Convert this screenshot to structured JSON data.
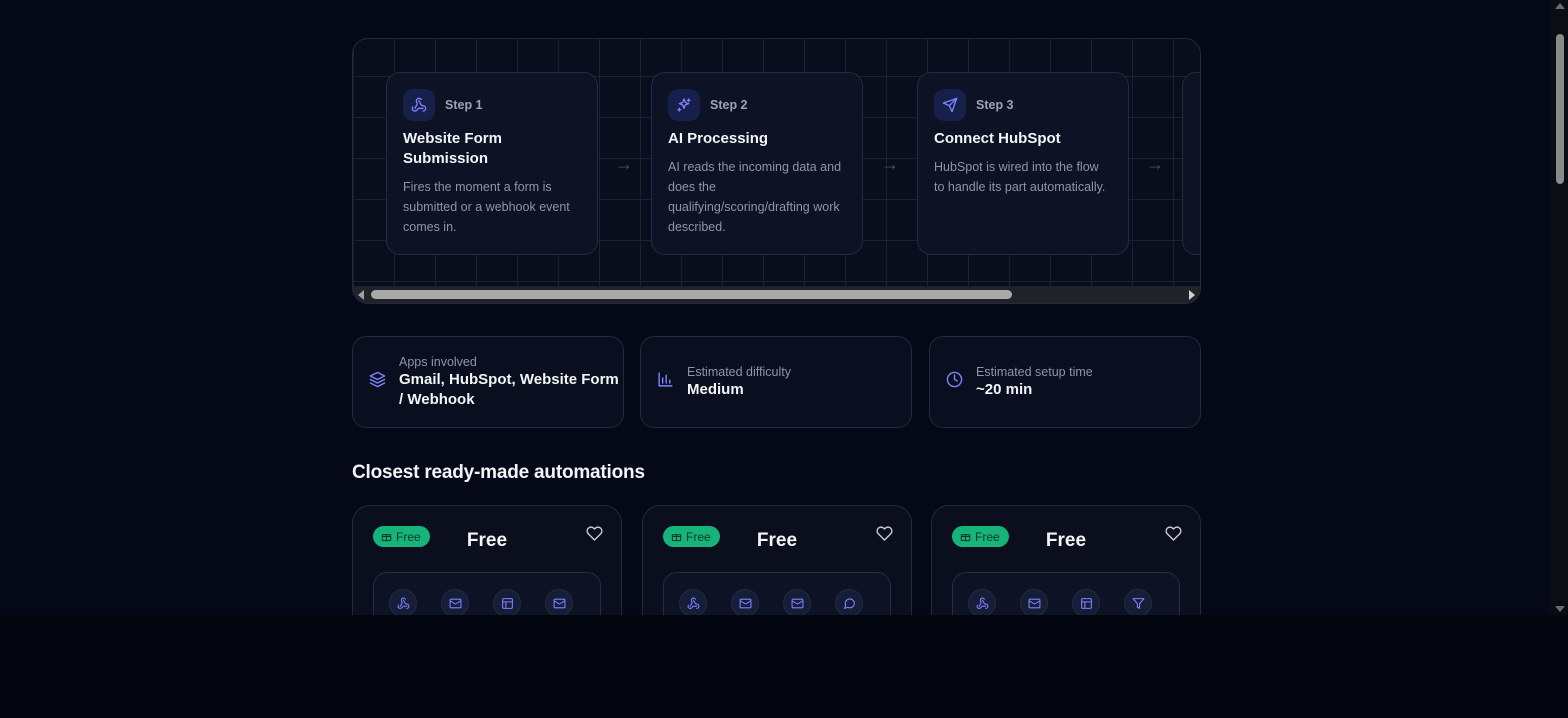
{
  "steps": [
    {
      "label": "Step 1",
      "title": "Website Form Submission",
      "desc": "Fires the moment a form is submitted or a webhook event comes in.",
      "icon": "webhook-icon"
    },
    {
      "label": "Step 2",
      "title": "AI Processing",
      "desc": "AI reads the incoming data and does the qualifying/scoring/drafting work described.",
      "icon": "sparkles-icon"
    },
    {
      "label": "Step 3",
      "title": "Connect HubSpot",
      "desc": "HubSpot is wired into the flow to handle its part automatically.",
      "icon": "send-icon"
    }
  ],
  "info": {
    "apps": {
      "label": "Apps involved",
      "value": "Gmail, HubSpot, Website Form / Webhook",
      "icon": "layers-icon"
    },
    "difficulty": {
      "label": "Estimated difficulty",
      "value": "Medium",
      "icon": "bar-chart-icon"
    },
    "time": {
      "label": "Estimated setup time",
      "value": "~20 min",
      "icon": "clock-icon"
    }
  },
  "section_title": "Closest ready-made automations",
  "automations": [
    {
      "badge": "Free",
      "price": "Free",
      "apps": [
        "webhook-icon",
        "mail-icon",
        "table-icon",
        "mail-icon"
      ]
    },
    {
      "badge": "Free",
      "price": "Free",
      "apps": [
        "webhook-icon",
        "mail-icon",
        "mail-icon",
        "chat-icon"
      ]
    },
    {
      "badge": "Free",
      "price": "Free",
      "apps": [
        "webhook-icon",
        "mail-icon",
        "table-icon",
        "filter-icon"
      ]
    }
  ],
  "colors": {
    "accent": "#7c83ff",
    "badge": "#16b37a",
    "background": "#050817"
  }
}
